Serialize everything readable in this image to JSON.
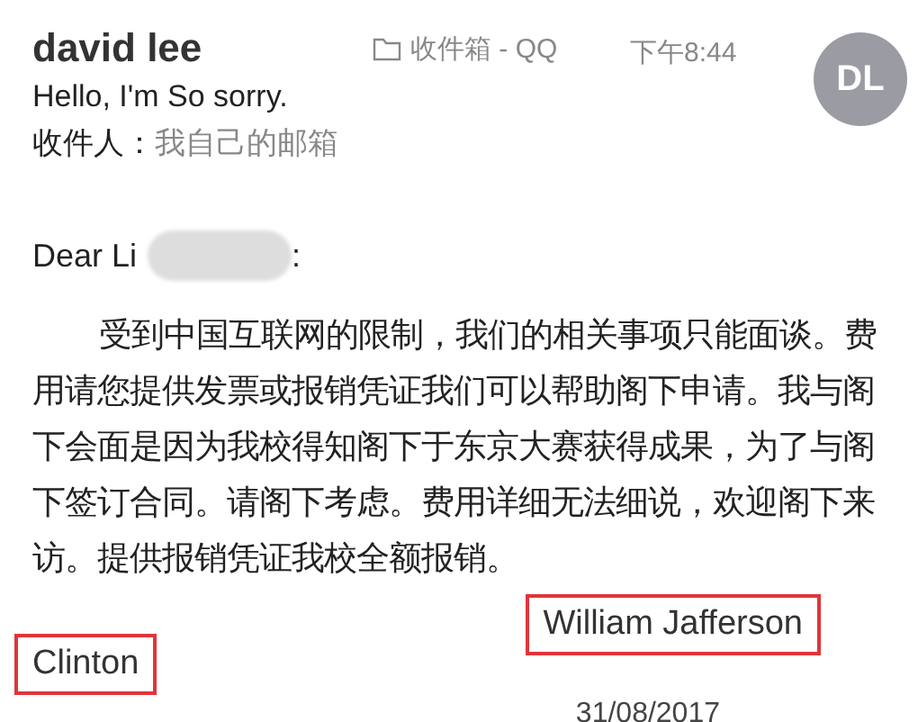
{
  "sender": {
    "name": "david lee",
    "initials": "DL"
  },
  "folder": "收件箱 - QQ",
  "time": "下午8:44",
  "subject": "Hello, I'm So sorry.",
  "recipient": {
    "label": "收件人：",
    "value": "我自己的邮箱"
  },
  "greeting": {
    "text": "Dear Li",
    "redacted": true,
    "end": ":"
  },
  "paragraph": "受到中国互联网的限制，我们的相关事项只能面谈。费用请您提供发票或报销凭证我们可以帮助阁下申请。我与阁下会面是因为我校得知阁下于东京大赛获得成果，为了与阁下签订合同。请阁下考虑。费用详细无法细说，欢迎阁下来访。提供报销凭证我校全额报销。",
  "signature": [
    {
      "text": "William Jafferson",
      "highlighted": true
    },
    {
      "text": "Clinton",
      "highlighted": true
    }
  ],
  "date": "31/08/2017"
}
